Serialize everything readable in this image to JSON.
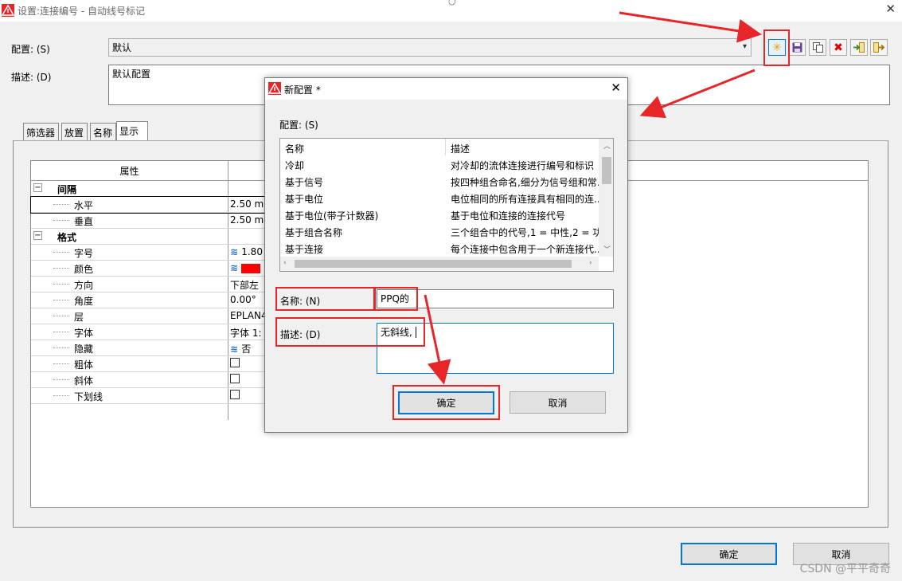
{
  "window": {
    "title": "设置:连接编号 - 自动线号标记"
  },
  "config": {
    "label": "配置: (S)",
    "value": "默认",
    "desc_label": "描述: (D)",
    "desc_value": "默认配置"
  },
  "tabs": [
    "筛选器",
    "放置",
    "名称",
    "显示"
  ],
  "property_table": {
    "header": "属性",
    "rows": [
      {
        "label": "间隔",
        "value": ""
      },
      {
        "label": "水平",
        "value": "2.50 mm"
      },
      {
        "label": "垂直",
        "value": "2.50 mm"
      },
      {
        "label": "格式",
        "value": ""
      },
      {
        "label": "字号",
        "value": "1.80"
      },
      {
        "label": "颜色",
        "value": ""
      },
      {
        "label": "方向",
        "value": "下部左"
      },
      {
        "label": "角度",
        "value": "0.00°"
      },
      {
        "label": "层",
        "value": "EPLAN4"
      },
      {
        "label": "字体",
        "value": "字体 1: "
      },
      {
        "label": "隐藏",
        "value": "否"
      },
      {
        "label": "粗体",
        "value": ""
      },
      {
        "label": "斜体",
        "value": ""
      },
      {
        "label": "下划线",
        "value": ""
      }
    ]
  },
  "dialog": {
    "title": "新配置 *",
    "config_label": "配置: (S)",
    "list_headers": [
      "名称",
      "描述"
    ],
    "list_rows": [
      {
        "name": "冷却",
        "desc": "对冷却的流体连接进行编号和标识"
      },
      {
        "name": "基于信号",
        "desc": "按四种组合命名,细分为信号组和常..."
      },
      {
        "name": "基于电位",
        "desc": "电位相同的所有连接具有相同的连..."
      },
      {
        "name": "基于电位(带子计数器)",
        "desc": "基于电位和连接的连接代号"
      },
      {
        "name": "基于组合名称",
        "desc": "三个组合中的代号,1 = 中性,2 = 功"
      },
      {
        "name": "基于连接",
        "desc": "每个连接中包含用于一个新连接代..."
      }
    ],
    "name_label": "名称: (N)",
    "name_value": "PPQ的",
    "desc_label": "描述: (D)",
    "desc_value": "无斜线,",
    "ok": "确定",
    "cancel": "取消"
  },
  "footer": {
    "ok": "确定",
    "cancel": "取消"
  },
  "watermark": "CSDN @平平奇奇",
  "colors": {
    "annotation": "#e8262a",
    "accent": "#0078d7",
    "swatch_red": "#ff0000"
  },
  "icons": [
    "warning-app-icon",
    "new-config-icon",
    "save-icon",
    "copy-icon",
    "delete-icon",
    "import-icon",
    "export-icon"
  ]
}
